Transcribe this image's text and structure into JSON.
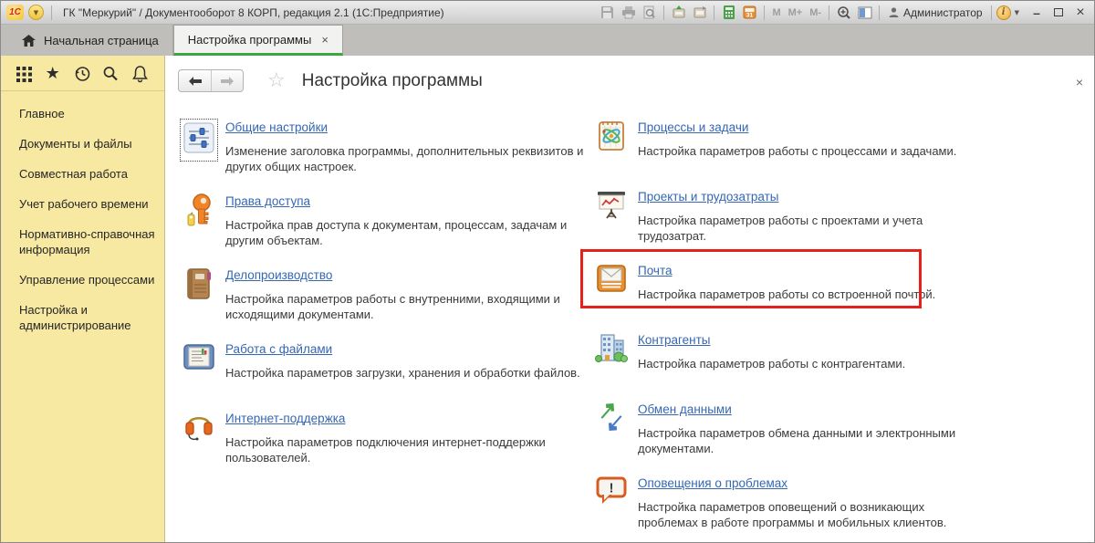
{
  "titlebar": {
    "app_title": "ГК \"Меркурий\" / Документооборот 8 КОРП, редакция 2.1  (1С:Предприятие)",
    "user_label": "Администратор",
    "memory_buttons": [
      "M",
      "M+",
      "M-"
    ]
  },
  "icons": {
    "logo_text": "1С",
    "menu_caret": "▼",
    "info_caret": "▼",
    "calendar_day": "31",
    "info_i": "i",
    "tab_close": "×",
    "page_close": "×",
    "star_filled": "★",
    "star_outline": "☆",
    "minimize_glyph": "–",
    "close_glyph": "×"
  },
  "tabs": [
    {
      "label": "Начальная страница",
      "active": false
    },
    {
      "label": "Настройка программы",
      "active": true
    }
  ],
  "sidebar": {
    "items": [
      "Главное",
      "Документы и файлы",
      "Совместная работа",
      "Учет рабочего времени",
      "Нормативно-справочная информация",
      "Управление процессами",
      "Настройка и администрирование"
    ]
  },
  "main": {
    "title": "Настройка программы",
    "left_items": [
      {
        "title": "Общие настройки",
        "desc": "Изменение заголовка программы, дополнительных реквизитов и других общих настроек.",
        "icon": "sliders-icon"
      },
      {
        "title": "Права доступа",
        "desc": "Настройка прав доступа к документам, процессам, задачам и другим объектам.",
        "icon": "keys-icon"
      },
      {
        "title": "Делопроизводство",
        "desc": "Настройка параметров работы с внутренними, входящими и исходящими документами.",
        "icon": "journal-icon"
      },
      {
        "title": "Работа с файлами",
        "desc": "Настройка параметров загрузки, хранения и обработки файлов.",
        "icon": "file-tablet-icon"
      },
      {
        "title": "Интернет-поддержка",
        "desc": "Настройка параметров подключения интернет-поддержки пользователей.",
        "icon": "headphones-icon"
      }
    ],
    "right_items": [
      {
        "title": "Процессы и задачи",
        "desc": "Настройка параметров работы с процессами и задачами.",
        "icon": "notepad-chart-icon"
      },
      {
        "title": "Проекты и трудозатраты",
        "desc": "Настройка параметров работы с проектами и учета трудозатрат.",
        "icon": "presentation-chart-icon"
      },
      {
        "title": "Почта",
        "desc": "Настройка параметров работы со встроенной почтой.",
        "icon": "mail-tray-icon",
        "highlighted": true
      },
      {
        "title": "Контрагенты",
        "desc": "Настройка параметров работы с контрагентами.",
        "icon": "building-icon"
      },
      {
        "title": "Обмен данными",
        "desc": "Настройка параметров обмена данными и электронными документами.",
        "icon": "exchange-arrows-icon"
      },
      {
        "title": "Оповещения о проблемах",
        "desc": "Настройка параметров оповещений о возникающих проблемах в работе программы и мобильных клиентов.",
        "icon": "alert-bubble-icon"
      }
    ]
  },
  "colors": {
    "accent_green": "#3aa83d",
    "link_blue": "#3567b2",
    "highlight_red": "#e6211b",
    "sidebar_yellow": "#f7e9a2"
  }
}
